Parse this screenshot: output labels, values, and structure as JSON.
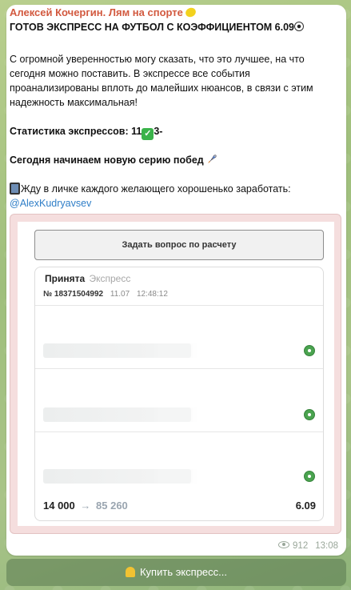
{
  "post": {
    "author": "Алексей Кочергин. Лям на спорте",
    "author_emoji": "lemon-icon",
    "headline": "ГОТОВ ЭКСПРЕСС НА ФУТБОЛ С КОЭФФИЦИЕНТОМ 6.09",
    "headline_emoji": "soccer-ball-icon",
    "paragraph1": "С огромной уверенностью могу сказать, что это лучшее, на что сегодня можно поставить. В экспрессе все события проанализированы вплоть до малейших нюансов, в связи с этим надежность максимальная!",
    "stats_prefix": "Статистика экспрессов: 11",
    "stats_suffix": "3-",
    "series_text": "Сегодня начинаем новую серию побед",
    "invite_text": "Жду в личке каждого желающего хорошенько заработать:",
    "contact_link": "@AlexKudryavsev",
    "views": "912",
    "time": "13:08"
  },
  "bet_screenshot": {
    "ask_button": "Задать вопрос по расчету",
    "status": "Принята",
    "bet_type": "Экспресс",
    "bet_id": "№ 18371504992",
    "date": "11.07",
    "bet_time": "12:48:12",
    "stake": "14 000",
    "arrow": "→",
    "payout": "85 260",
    "coefficient": "6.09"
  },
  "bottom_button": {
    "label": "Купить экспресс...",
    "icon": "bell-icon"
  }
}
